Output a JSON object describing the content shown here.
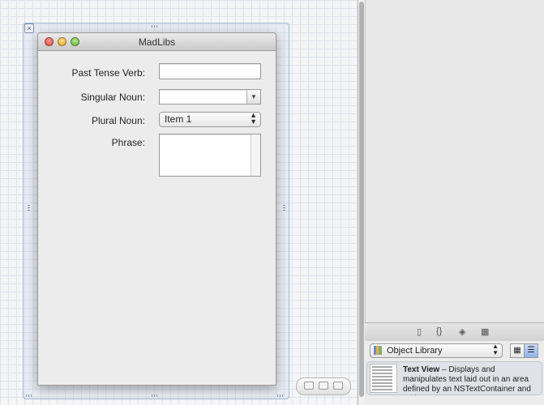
{
  "window": {
    "title": "MadLibs"
  },
  "form": {
    "past_tense_verb": {
      "label": "Past Tense Verb:",
      "value": ""
    },
    "singular_noun": {
      "label": "Singular Noun:",
      "value": ""
    },
    "plural_noun": {
      "label": "Plural Noun:",
      "selected": "Item 1"
    },
    "phrase": {
      "label": "Phrase:",
      "value": ""
    }
  },
  "library": {
    "selector": "Object Library",
    "item": {
      "title": "Text View",
      "description": " – Displays and manipulates text laid out in an area defined by an NSTextContainer and adds many..."
    }
  },
  "icons": {
    "close": "close-icon",
    "file": "file-icon",
    "braces": "braces-icon",
    "cube": "cube-icon",
    "grid": "grid-icon",
    "library": "library-icon",
    "icon_view": "icon-view-icon",
    "list_view": "list-view-icon"
  }
}
